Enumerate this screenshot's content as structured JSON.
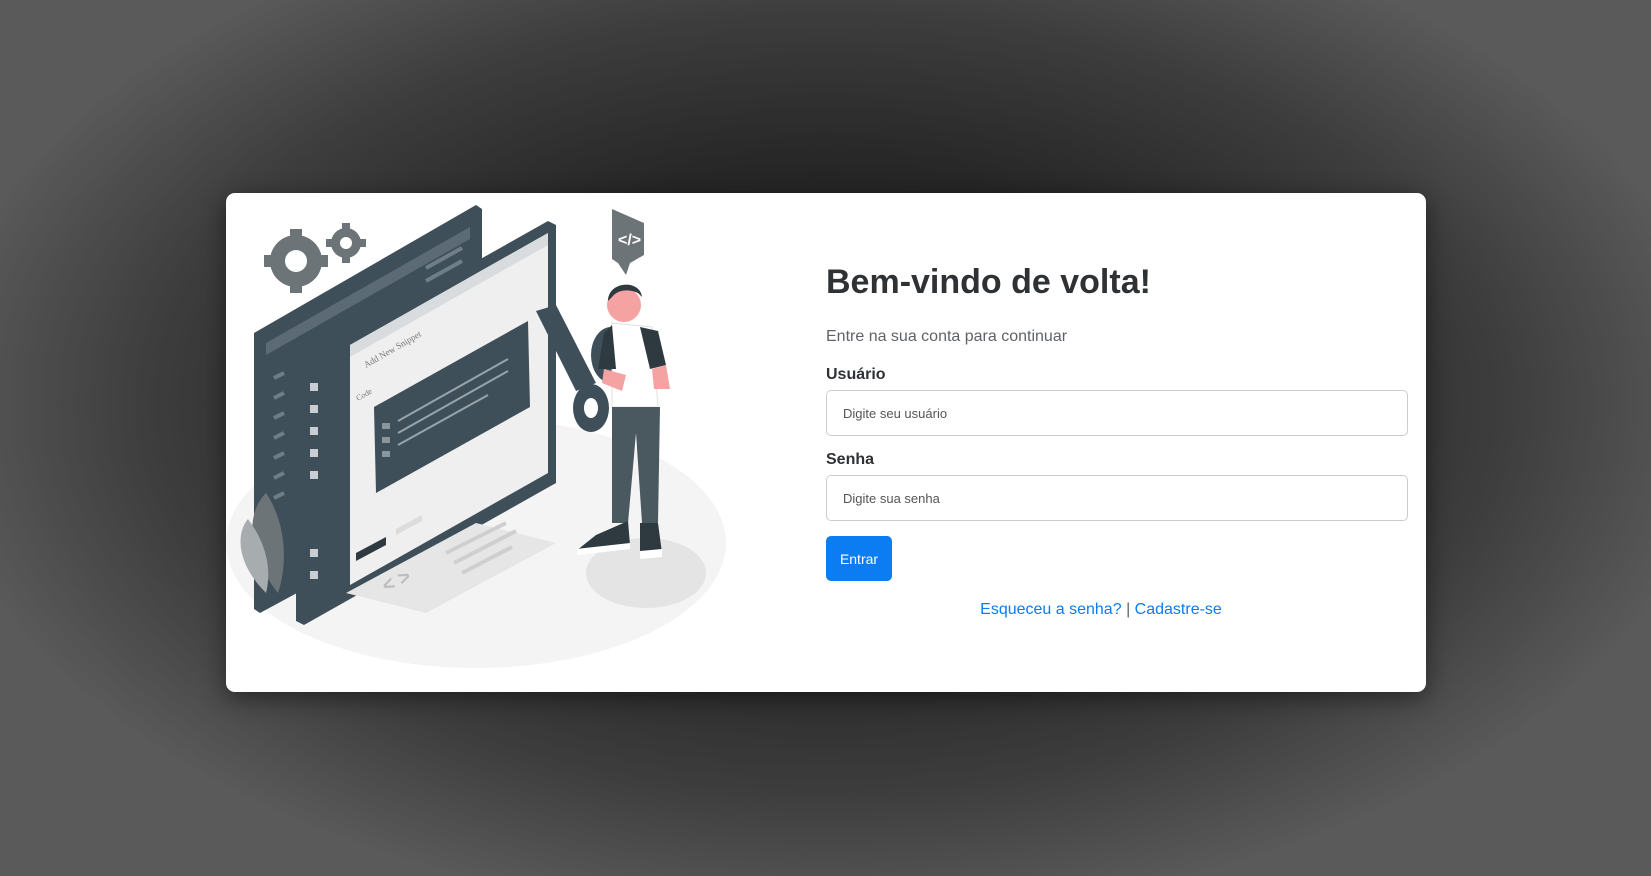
{
  "login": {
    "title": "Bem-vindo de volta!",
    "subtitle": "Entre na sua conta para continuar",
    "username_label": "Usuário",
    "username_placeholder": "Digite seu usuário",
    "password_label": "Senha",
    "password_placeholder": "Digite sua senha",
    "submit_label": "Entrar",
    "forgot_link": "Esqueceu a senha?",
    "separator": "|",
    "signup_link": "Cadastre-se"
  },
  "illustration": {
    "snippet_title": "Add New Snippet",
    "code_label": "Code",
    "icon": "developer-with-scissors-illustration"
  },
  "colors": {
    "accent": "#0b7cf2",
    "title": "#2f3235",
    "illustration_dark": "#3f4f5a"
  }
}
